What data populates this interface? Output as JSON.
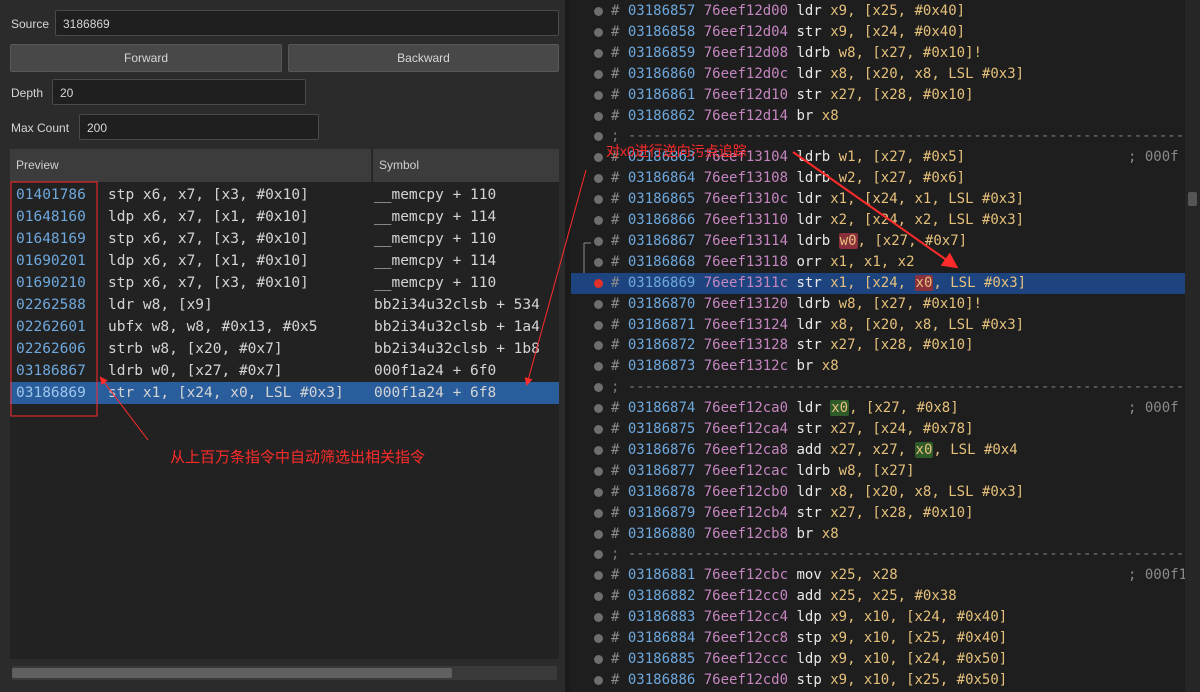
{
  "left": {
    "source_label": "Source",
    "source_value": "3186869",
    "forward_label": "Forward",
    "backward_label": "Backward",
    "depth_label": "Depth",
    "depth_value": "20",
    "max_count_label": "Max Count",
    "max_count_value": "200",
    "table": {
      "headers": [
        "Preview",
        "Symbol"
      ],
      "rows": [
        {
          "idx": "01401786",
          "ins": "stp x6, x7, [x3, #0x10]",
          "sym": "__memcpy + 110"
        },
        {
          "idx": "01648160",
          "ins": "ldp x6, x7, [x1, #0x10]",
          "sym": "__memcpy + 114"
        },
        {
          "idx": "01648169",
          "ins": "stp x6, x7, [x3, #0x10]",
          "sym": "__memcpy + 110"
        },
        {
          "idx": "01690201",
          "ins": "ldp x6, x7, [x1, #0x10]",
          "sym": "__memcpy + 114"
        },
        {
          "idx": "01690210",
          "ins": "stp x6, x7, [x3, #0x10]",
          "sym": "__memcpy + 110"
        },
        {
          "idx": "02262588",
          "ins": "ldr w8, [x9]",
          "sym": "bb2i34u32clsb + 534"
        },
        {
          "idx": "02262601",
          "ins": "ubfx w8, w8, #0x13, #0x5",
          "sym": "bb2i34u32clsb + 1a4"
        },
        {
          "idx": "02262606",
          "ins": "strb w8, [x20, #0x7]",
          "sym": "bb2i34u32clsb + 1b8"
        },
        {
          "idx": "03186867",
          "ins": "ldrb w0, [x27, #0x7]",
          "sym": "000f1a24 + 6f0"
        },
        {
          "idx": "03186869",
          "ins": "str x1, [x24, x0, LSL #0x3]",
          "sym": "000f1a24 + 6f8",
          "selected": true
        }
      ]
    }
  },
  "right": {
    "lines": [
      {
        "kind": "ins",
        "ln": "03186857",
        "addr": "76eef12d00",
        "mn": "ldr",
        "ops": "x9, [x25, #0x40]"
      },
      {
        "kind": "ins",
        "ln": "03186858",
        "addr": "76eef12d04",
        "mn": "str",
        "ops": "x9, [x24, #0x40]"
      },
      {
        "kind": "ins",
        "ln": "03186859",
        "addr": "76eef12d08",
        "mn": "ldrb",
        "ops": "w8, [x27, #0x10]!"
      },
      {
        "kind": "ins",
        "ln": "03186860",
        "addr": "76eef12d0c",
        "mn": "ldr",
        "ops": "x8, [x20, x8, LSL #0x3]"
      },
      {
        "kind": "ins",
        "ln": "03186861",
        "addr": "76eef12d10",
        "mn": "str",
        "ops": "x27, [x28, #0x10]"
      },
      {
        "kind": "ins",
        "ln": "03186862",
        "addr": "76eef12d14",
        "mn": "br",
        "ops": "x8"
      },
      {
        "kind": "sep",
        "text": "; --------------------------------------------------------------------------"
      },
      {
        "kind": "ins",
        "ln": "03186863",
        "addr": "76eef13104",
        "mn": "ldrb",
        "ops": "w1, [x27, #0x5]",
        "comment": "; 000f"
      },
      {
        "kind": "ins",
        "ln": "03186864",
        "addr": "76eef13108",
        "mn": "ldrb",
        "ops": "w2, [x27, #0x6]"
      },
      {
        "kind": "ins",
        "ln": "03186865",
        "addr": "76eef1310c",
        "mn": "ldr",
        "ops": "x1, [x24, x1, LSL #0x3]"
      },
      {
        "kind": "ins",
        "ln": "03186866",
        "addr": "76eef13110",
        "mn": "ldr",
        "ops": "x2, [x24, x2, LSL #0x3]"
      },
      {
        "kind": "ins",
        "ln": "03186867",
        "addr": "76eef13114",
        "mn": "ldrb",
        "ops_pre": "",
        "hl": "w0",
        "hl_color": "#8a2f3c",
        "ops_post": ", [x27, #0x7]"
      },
      {
        "kind": "ins",
        "ln": "03186868",
        "addr": "76eef13118",
        "mn": "orr",
        "ops": "x1, x1, x2"
      },
      {
        "kind": "ins",
        "ln": "03186869",
        "addr": "76eef1311c",
        "mn": "str",
        "ops_pre": "x1, [x24, ",
        "hl": "x0",
        "hl_color": "#8a2f3c",
        "ops_post": ", LSL #0x3]",
        "selected": true,
        "breakpoint": true
      },
      {
        "kind": "ins",
        "ln": "03186870",
        "addr": "76eef13120",
        "mn": "ldrb",
        "ops": "w8, [x27, #0x10]!"
      },
      {
        "kind": "ins",
        "ln": "03186871",
        "addr": "76eef13124",
        "mn": "ldr",
        "ops": "x8, [x20, x8, LSL #0x3]"
      },
      {
        "kind": "ins",
        "ln": "03186872",
        "addr": "76eef13128",
        "mn": "str",
        "ops": "x27, [x28, #0x10]"
      },
      {
        "kind": "ins",
        "ln": "03186873",
        "addr": "76eef1312c",
        "mn": "br",
        "ops": "x8"
      },
      {
        "kind": "sep",
        "text": "; --------------------------------------------------------------------------"
      },
      {
        "kind": "ins",
        "ln": "03186874",
        "addr": "76eef12ca0",
        "mn": "ldr",
        "ops_pre": "",
        "hl": "x0",
        "hl_color": "#2f5a2a",
        "ops_post": ", [x27, #0x8]",
        "comment": "; 000f"
      },
      {
        "kind": "ins",
        "ln": "03186875",
        "addr": "76eef12ca4",
        "mn": "str",
        "ops": "x27, [x24, #0x78]"
      },
      {
        "kind": "ins",
        "ln": "03186876",
        "addr": "76eef12ca8",
        "mn": "add",
        "ops_pre": "x27, x27, ",
        "hl": "x0",
        "hl_color": "#2f5a2a",
        "ops_post": ", LSL #0x4"
      },
      {
        "kind": "ins",
        "ln": "03186877",
        "addr": "76eef12cac",
        "mn": "ldrb",
        "ops": "w8, [x27]"
      },
      {
        "kind": "ins",
        "ln": "03186878",
        "addr": "76eef12cb0",
        "mn": "ldr",
        "ops": "x8, [x20, x8, LSL #0x3]"
      },
      {
        "kind": "ins",
        "ln": "03186879",
        "addr": "76eef12cb4",
        "mn": "str",
        "ops": "x27, [x28, #0x10]"
      },
      {
        "kind": "ins",
        "ln": "03186880",
        "addr": "76eef12cb8",
        "mn": "br",
        "ops": "x8"
      },
      {
        "kind": "sep",
        "text": "; --------------------------------------------------------------------------"
      },
      {
        "kind": "ins",
        "ln": "03186881",
        "addr": "76eef12cbc",
        "mn": "mov",
        "ops": "x25, x28",
        "comment": "; 000f1"
      },
      {
        "kind": "ins",
        "ln": "03186882",
        "addr": "76eef12cc0",
        "mn": "add",
        "ops": "x25, x25, #0x38"
      },
      {
        "kind": "ins",
        "ln": "03186883",
        "addr": "76eef12cc4",
        "mn": "ldp",
        "ops": "x9, x10, [x24, #0x40]"
      },
      {
        "kind": "ins",
        "ln": "03186884",
        "addr": "76eef12cc8",
        "mn": "stp",
        "ops": "x9, x10, [x25, #0x40]"
      },
      {
        "kind": "ins",
        "ln": "03186885",
        "addr": "76eef12ccc",
        "mn": "ldp",
        "ops": "x9, x10, [x24, #0x50]"
      },
      {
        "kind": "ins",
        "ln": "03186886",
        "addr": "76eef12cd0",
        "mn": "stp",
        "ops": "x9, x10, [x25, #0x50]"
      }
    ]
  },
  "annotations": {
    "taint_label": "对x0进行逆向污点追踪",
    "filter_label": "从上百万条指令中自动筛选出相关指令",
    "color": "#ff2b2b"
  }
}
